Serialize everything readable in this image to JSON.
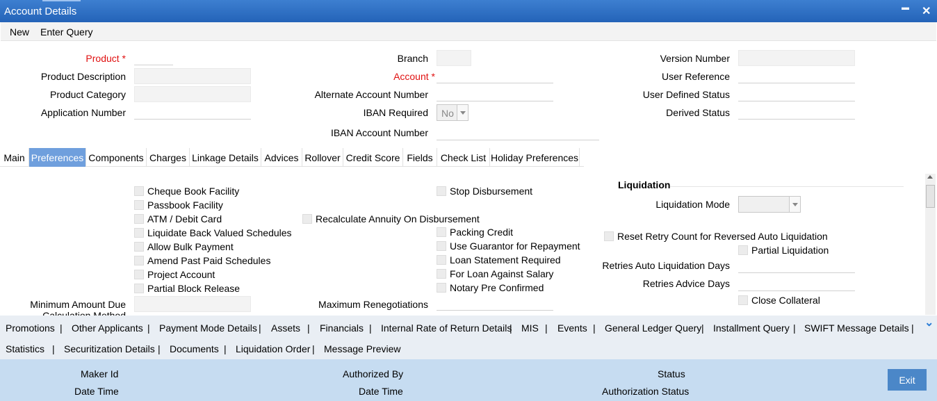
{
  "window": {
    "title": "Account Details",
    "minimize_label": "▬",
    "close_label": "✕"
  },
  "menu": {
    "new": "New",
    "enter_query": "Enter Query"
  },
  "header": {
    "product_label": "Product",
    "required_mark": "*",
    "product_description_label": "Product Description",
    "product_category_label": "Product Category",
    "application_number_label": "Application Number",
    "branch_label": "Branch",
    "account_label": "Account",
    "alternate_account_label": "Alternate Account Number",
    "iban_required_label": "IBAN Required",
    "iban_required_value": "No",
    "iban_account_label": "IBAN Account Number",
    "version_number_label": "Version Number",
    "user_reference_label": "User Reference",
    "user_defined_status_label": "User Defined Status",
    "derived_status_label": "Derived Status"
  },
  "tabs": [
    "Main",
    "Preferences",
    "Components",
    "Charges",
    "Linkage Details",
    "Advices",
    "Rollover",
    "Credit Score",
    "Fields",
    "Check List",
    "Holiday Preferences"
  ],
  "active_tab": "Preferences",
  "preferences": {
    "col1": [
      "Cheque Book Facility",
      "Passbook Facility",
      "ATM / Debit Card",
      "Liquidate Back Valued Schedules",
      "Allow Bulk Payment",
      "Amend Past Paid Schedules",
      "Project Account",
      "Partial Block Release"
    ],
    "recalc": "Recalculate Annuity On Disbursement",
    "stop_disbursement": "Stop Disbursement",
    "col2": [
      "Packing Credit",
      "Use Guarantor for Repayment",
      "Loan Statement Required",
      "For Loan Against Salary",
      "Notary Pre Confirmed"
    ],
    "min_amount_label_1": "Minimum Amount Due",
    "min_amount_label_2": "Calculation Method",
    "max_reneg_label": "Maximum Renegotiations",
    "liquidation": {
      "heading": "Liquidation",
      "mode_label": "Liquidation Mode",
      "reset_retry": "Reset Retry Count for Reversed Auto Liquidation",
      "partial": "Partial Liquidation",
      "retries_auto_label": "Retries Auto Liquidation Days",
      "retries_advice_label": "Retries Advice Days",
      "close_collateral": "Close Collateral"
    }
  },
  "bottom_links": {
    "row1": [
      "Promotions",
      "Other Applicants",
      "Payment Mode Details",
      "Assets",
      "Financials",
      "Internal Rate of Return Details",
      "MIS",
      "Events",
      "General Ledger Query",
      "Installment Query",
      "SWIFT Message Details"
    ],
    "row2": [
      "Statistics",
      "Securitization Details",
      "Documents",
      "Liquidation Order",
      "Message Preview"
    ],
    "separator": "|",
    "expand_icon_glyph": "⌄"
  },
  "footer": {
    "maker_id": "Maker Id",
    "date_time": "Date Time",
    "authorized_by": "Authorized By",
    "status": "Status",
    "authorization_status": "Authorization Status",
    "exit": "Exit"
  }
}
